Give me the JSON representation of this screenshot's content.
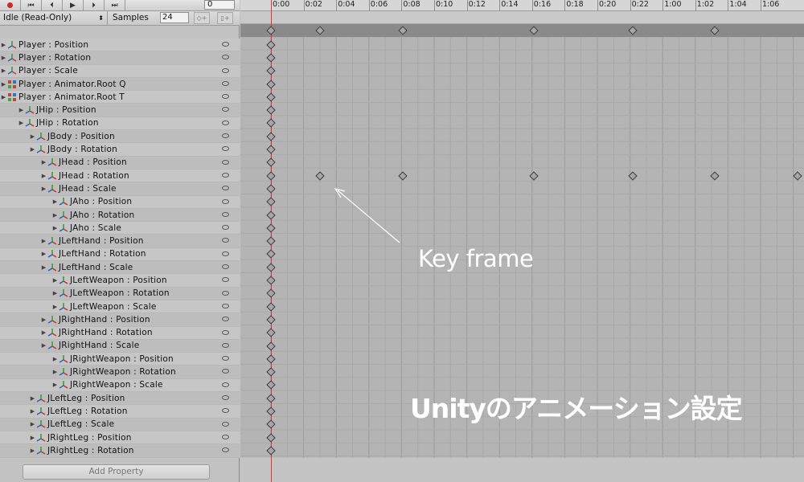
{
  "toolbar": {
    "record_icon": "record-icon",
    "first_icon": "first-key-icon",
    "prev_icon": "prev-key-icon",
    "play_icon": "play-icon",
    "next_icon": "next-key-icon",
    "last_icon": "last-key-icon",
    "frame_value": "0"
  },
  "clip": {
    "selected": "Idle (Read-Only)",
    "samples_label": "Samples",
    "samples_value": "24"
  },
  "properties": [
    {
      "indent": 0,
      "label": "Player : Position",
      "icon": "transform-icon"
    },
    {
      "indent": 0,
      "label": "Player : Rotation",
      "icon": "transform-icon"
    },
    {
      "indent": 0,
      "label": "Player : Scale",
      "icon": "transform-icon"
    },
    {
      "indent": 0,
      "label": "Player : Animator.Root Q",
      "icon": "animator-icon"
    },
    {
      "indent": 0,
      "label": "Player : Animator.Root T",
      "icon": "animator-icon"
    },
    {
      "indent": 1,
      "label": "JHip : Position",
      "icon": "transform-icon"
    },
    {
      "indent": 1,
      "label": "JHip : Rotation",
      "icon": "transform-icon"
    },
    {
      "indent": 2,
      "label": "JBody : Position",
      "icon": "transform-icon"
    },
    {
      "indent": 2,
      "label": "JBody : Rotation",
      "icon": "transform-icon"
    },
    {
      "indent": 3,
      "label": "JHead : Position",
      "icon": "transform-icon"
    },
    {
      "indent": 3,
      "label": "JHead : Rotation",
      "icon": "transform-icon"
    },
    {
      "indent": 3,
      "label": "JHead : Scale",
      "icon": "transform-icon"
    },
    {
      "indent": 4,
      "label": "JAho : Position",
      "icon": "transform-icon"
    },
    {
      "indent": 4,
      "label": "JAho : Rotation",
      "icon": "transform-icon"
    },
    {
      "indent": 4,
      "label": "JAho : Scale",
      "icon": "transform-icon"
    },
    {
      "indent": 3,
      "label": "JLeftHand : Position",
      "icon": "transform-icon"
    },
    {
      "indent": 3,
      "label": "JLeftHand : Rotation",
      "icon": "transform-icon"
    },
    {
      "indent": 3,
      "label": "JLeftHand : Scale",
      "icon": "transform-icon"
    },
    {
      "indent": 4,
      "label": "JLeftWeapon : Position",
      "icon": "transform-icon"
    },
    {
      "indent": 4,
      "label": "JLeftWeapon : Rotation",
      "icon": "transform-icon"
    },
    {
      "indent": 4,
      "label": "JLeftWeapon : Scale",
      "icon": "transform-icon"
    },
    {
      "indent": 3,
      "label": "JRightHand : Position",
      "icon": "transform-icon"
    },
    {
      "indent": 3,
      "label": "JRightHand : Rotation",
      "icon": "transform-icon"
    },
    {
      "indent": 3,
      "label": "JRightHand : Scale",
      "icon": "transform-icon"
    },
    {
      "indent": 4,
      "label": "JRightWeapon : Position",
      "icon": "transform-icon"
    },
    {
      "indent": 4,
      "label": "JRightWeapon : Rotation",
      "icon": "transform-icon"
    },
    {
      "indent": 4,
      "label": "JRightWeapon : Scale",
      "icon": "transform-icon"
    },
    {
      "indent": 2,
      "label": "JLeftLeg : Position",
      "icon": "transform-icon"
    },
    {
      "indent": 2,
      "label": "JLeftLeg : Rotation",
      "icon": "transform-icon"
    },
    {
      "indent": 2,
      "label": "JLeftLeg : Scale",
      "icon": "transform-icon"
    },
    {
      "indent": 2,
      "label": "JRightLeg : Position",
      "icon": "transform-icon"
    },
    {
      "indent": 2,
      "label": "JRightLeg : Rotation",
      "icon": "transform-icon"
    }
  ],
  "add_property_label": "Add Property",
  "timeline": {
    "ticks": [
      "0:00",
      "0:02",
      "0:04",
      "0:06",
      "0:08",
      "0:10",
      "0:12",
      "0:14",
      "0:16",
      "0:18",
      "0:20",
      "0:22",
      "1:00",
      "1:02",
      "1:04",
      "1:06"
    ],
    "keyframes_summary": [
      "0:00",
      "0:02",
      "0:08",
      "0:16",
      "0:22",
      "1:02"
    ],
    "keyframes_rotation_row": "JHead : Rotation",
    "keyframes_rotation": [
      "0:00",
      "0:02",
      "0:08",
      "0:16",
      "0:22",
      "1:02",
      "1:08"
    ],
    "playhead": "0:00"
  },
  "annotation": {
    "arrow_label": "Key frame",
    "caption": "Unityのアニメーション設定"
  },
  "colors": {
    "playhead": "#e23232",
    "annotation_text": "#ffffff"
  }
}
